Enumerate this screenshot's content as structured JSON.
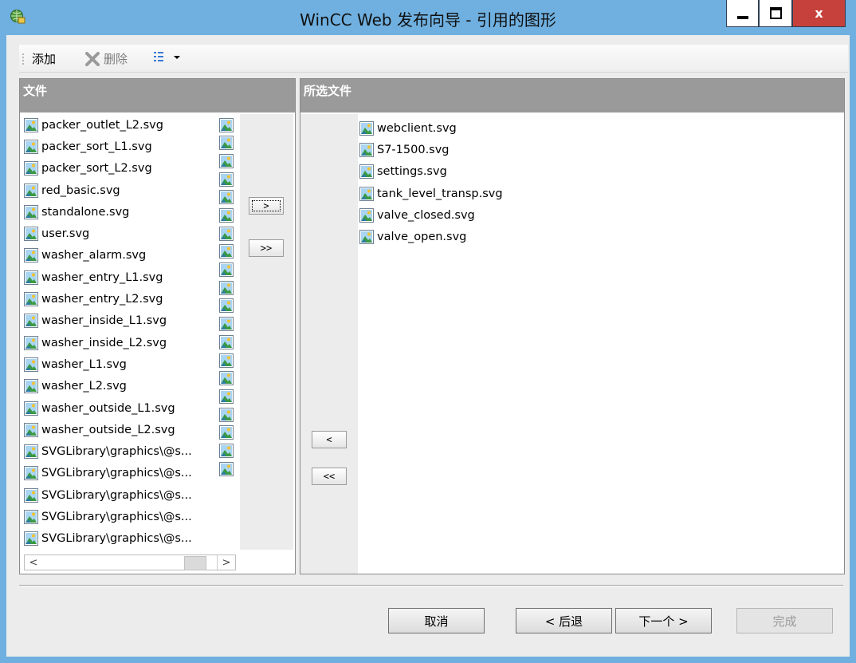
{
  "window": {
    "title": "WinCC Web 发布向导 - 引用的图形",
    "close_glyph": "x"
  },
  "toolbar": {
    "add_label": "添加",
    "delete_label": "删除"
  },
  "left_panel": {
    "header": "文件",
    "items": [
      "packer_outlet_L2.svg",
      "packer_sort_L1.svg",
      "packer_sort_L2.svg",
      "red_basic.svg",
      "standalone.svg",
      "user.svg",
      "washer_alarm.svg",
      "washer_entry_L1.svg",
      "washer_entry_L2.svg",
      "washer_inside_L1.svg",
      "washer_inside_L2.svg",
      "washer_L1.svg",
      "washer_L2.svg",
      "washer_outside_L1.svg",
      "washer_outside_L2.svg",
      "SVGLibrary\\graphics\\@s...",
      "SVGLibrary\\graphics\\@s...",
      "SVGLibrary\\graphics\\@s...",
      "SVGLibrary\\graphics\\@s...",
      "SVGLibrary\\graphics\\@s..."
    ]
  },
  "transfer": {
    "add_one": ">",
    "add_all": ">>",
    "remove_one": "<",
    "remove_all": "<<"
  },
  "right_panel": {
    "header": "所选文件",
    "items": [
      "webclient.svg",
      "S7-1500.svg",
      "settings.svg",
      "tank_level_transp.svg",
      "valve_closed.svg",
      "valve_open.svg"
    ]
  },
  "scrollbar": {
    "left_arrow": "<",
    "right_arrow": ">"
  },
  "footer": {
    "cancel_label": "取消",
    "back_label": "< 后退",
    "next_label": "下一个 >",
    "finish_label": "完成"
  },
  "colors": {
    "titlebar": "#6fb0e0",
    "close_button": "#c7413c",
    "panel_header": "#9a9a9a"
  }
}
